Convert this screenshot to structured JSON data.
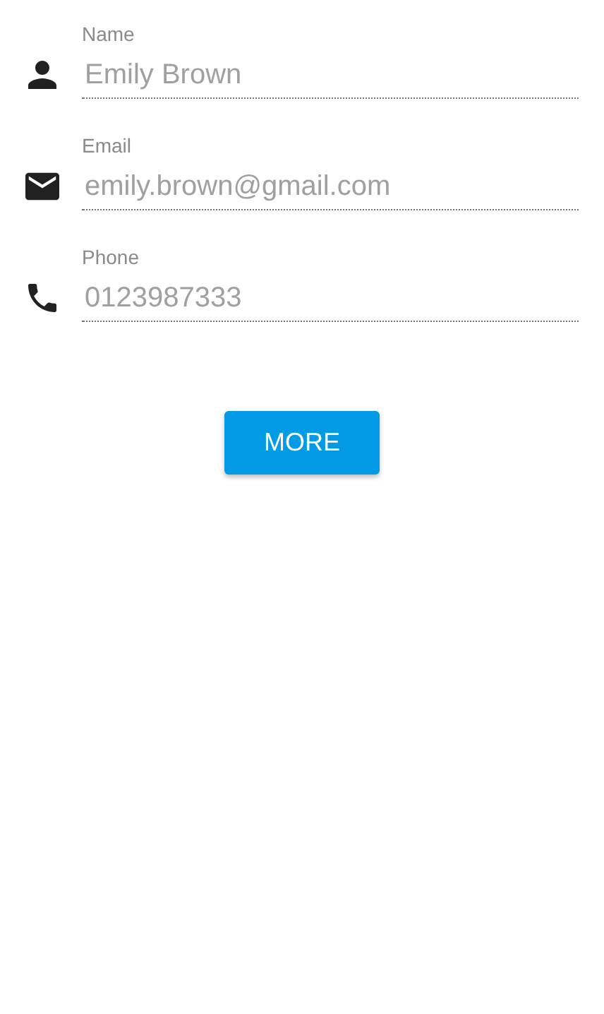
{
  "fields": [
    {
      "kind": "person",
      "label": "Name",
      "value": "Emily Brown",
      "disabled": true
    },
    {
      "kind": "email",
      "label": "Email",
      "value": "emily.brown@gmail.com",
      "disabled": true
    },
    {
      "kind": "phone",
      "label": "Phone",
      "value": "0123987333",
      "disabled": true
    }
  ],
  "button": {
    "label": "MORE"
  }
}
